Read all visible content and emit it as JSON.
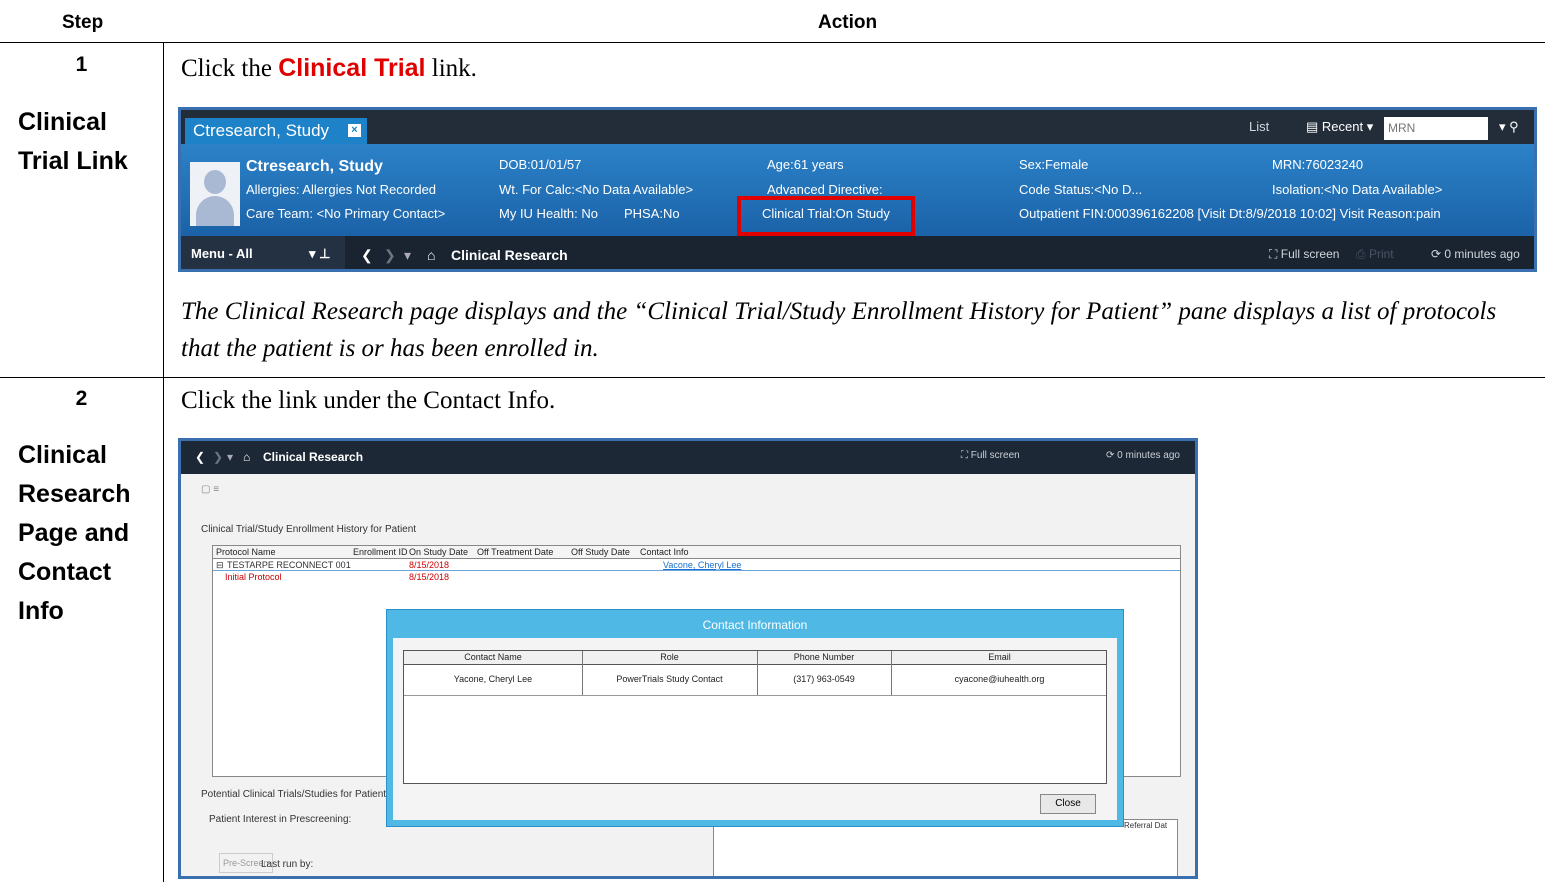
{
  "table": {
    "col_step": "Step",
    "col_action": "Action"
  },
  "step1": {
    "number": "1",
    "title": "Clinical Trial Link",
    "instruction_pre": "Click the ",
    "instruction_link": "Clinical Trial",
    "instruction_post": " link.",
    "result": "The Clinical Research page displays and the “Clinical Trial/Study Enrollment History for Patient” pane displays a list of protocols that the patient is or has been enrolled in."
  },
  "step2": {
    "number": "2",
    "title": "Clinical Research Page and Contact Info",
    "instruction": "Click the link under the Contact Info."
  },
  "banner": {
    "tab_label": "Ctresearch, Study",
    "list_label": "List",
    "recent_label": "Recent",
    "mrn_placeholder": "MRN",
    "patient_name": "Ctresearch, Study",
    "allergies": "Allergies: Allergies Not Recorded",
    "care_team": "Care Team: <No Primary Contact>",
    "dob": "DOB:01/01/57",
    "wt_for_calc": "Wt. For Calc:<No Data Available>",
    "my_iu_health": "My IU Health: No",
    "phsa": "PHSA:No",
    "age": "Age:61 years",
    "advanced_directive": "Advanced Directive:",
    "clinical_trial": "Clinical Trial:On Study",
    "sex": "Sex:Female",
    "code_status": "Code Status:<No D...",
    "outpatient_fin": "Outpatient FIN:000396162208 [Visit Dt:8/9/2018 10:02] Visit Reason:pain",
    "mrn": "MRN:76023240",
    "isolation": "Isolation:<No Data Available>",
    "menu_label": "Menu - All",
    "page_title": "Clinical Research",
    "full_screen": "Full screen",
    "print": "Print",
    "refresh": "0 minutes ago"
  },
  "research": {
    "page_title": "Clinical Research",
    "full_screen": "Full screen",
    "refresh": "0 minutes ago",
    "enrollment_pane_title": "Clinical Trial/Study Enrollment History for Patient",
    "grid_headers": [
      "Protocol Name",
      "Enrollment ID",
      "On Study Date",
      "Off Treatment Date",
      "Off Study Date",
      "Contact Info"
    ],
    "row1": {
      "protocol": "TESTARPE RECONNECT 001",
      "on_study": "8/15/2018",
      "contact": "Vacone, Cheryl Lee"
    },
    "row2": {
      "protocol": "Initial Protocol",
      "on_study": "8/15/2018"
    },
    "potential_title": "Potential Clinical Trials/Studies for Patient",
    "prescreening_label": "Patient Interest in Prescreening:",
    "prescreen_button": "Pre-Screen",
    "last_run_label": "Last run by:",
    "referral_label": "Referral Dat"
  },
  "contact_dialog": {
    "title": "Contact Information",
    "headers": [
      "Contact Name",
      "Role",
      "Phone Number",
      "Email"
    ],
    "row": [
      "Yacone, Cheryl Lee",
      "PowerTrials Study Contact",
      "(317) 963-0549",
      "cyacone@iuhealth.org"
    ],
    "close_button": "Close"
  },
  "colors": {
    "highlight_red": "#e00000",
    "banner_blue": "#2c82c8",
    "dark_bar": "#1a2330",
    "dialog_blue": "#4fb8e5"
  }
}
